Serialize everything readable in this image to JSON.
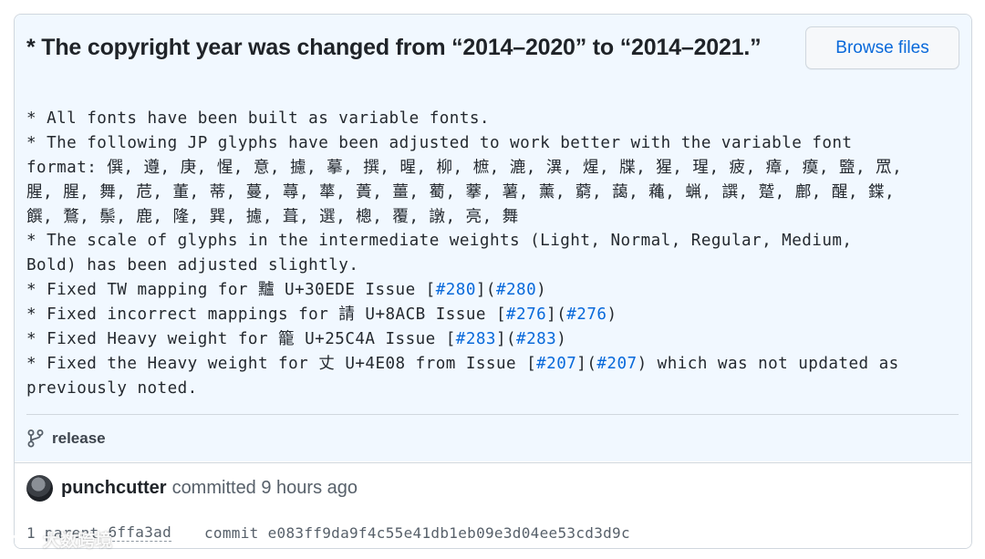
{
  "commit": {
    "title": "* The copyright year was changed from “2014–2020” to “2014–2021.”",
    "browse_label": "Browse files",
    "description_lines": [
      [
        {
          "t": "* All fonts have been built as variable fonts."
        }
      ],
      [
        {
          "t": "* The following JP glyphs have been adjusted to work better with the variable font"
        }
      ],
      [
        {
          "t": "format: 僎, 遵, 庚, 惺, 意, 攄, 摹, 撰, 暒, 柳, 樜, 漉, 潩, 煋, 牒, 猩, 瑆, 疲, 瘴, 瘼, 盬, 罛,"
        }
      ],
      [
        {
          "t": "腥, 腥, 舞, 苊, 董, 蒂, 蔓, 蕁, 蕐, 蕢, 薑, 薥, 藆, 薯, 薰, 藭, 藹, 蘒, 蝋, 譔, 蹵, 鄜, 醒, 鍱,"
        }
      ],
      [
        {
          "t": "饌, 鶩, 鬃, 鹿, 隆, 巽, 攄, 葺, 選, 樬, 覆, 譈, 亮, 舞"
        }
      ],
      [
        {
          "t": "* The scale of glyphs in the intermediate weights (Light, Normal, Regular, Medium,"
        }
      ],
      [
        {
          "t": "Bold) has been adjusted slightly."
        }
      ],
      [
        {
          "t": "* Fixed TW mapping for 黸 U+30EDE Issue ["
        },
        {
          "t": "#280",
          "link": true
        },
        {
          "t": "]("
        },
        {
          "t": "#280",
          "link": true
        },
        {
          "t": ")"
        }
      ],
      [
        {
          "t": "* Fixed incorrect mappings for 請 U+8ACB Issue ["
        },
        {
          "t": "#276",
          "link": true
        },
        {
          "t": "]("
        },
        {
          "t": "#276",
          "link": true
        },
        {
          "t": ")"
        }
      ],
      [
        {
          "t": "* Fixed Heavy weight for 籠 U+25C4A Issue ["
        },
        {
          "t": "#283",
          "link": true
        },
        {
          "t": "]("
        },
        {
          "t": "#283",
          "link": true
        },
        {
          "t": ")"
        }
      ],
      [
        {
          "t": "* Fixed the Heavy weight for 丈 U+4E08 from Issue ["
        },
        {
          "t": "#207",
          "link": true
        },
        {
          "t": "]("
        },
        {
          "t": "#207",
          "link": true
        },
        {
          "t": ") which was not updated as"
        }
      ],
      [
        {
          "t": "previously noted."
        }
      ]
    ],
    "branch": "release",
    "author": "punchcutter",
    "committed_text": "committed 9 hours ago",
    "parent_label": "1 parent",
    "parent_sha": "6ffa3ad",
    "commit_label": "commit",
    "commit_sha": "e083ff9da9f4c55e41db1eb09e3d04ee53cd3d9c"
  },
  "watermark": {
    "text": "大数跨境"
  },
  "colors": {
    "link": "#0969da",
    "body_bg": "#f1f8ff",
    "border": "#d0d7de"
  },
  "icons": {
    "branch": "git-branch-icon",
    "avatar": "user-avatar"
  }
}
